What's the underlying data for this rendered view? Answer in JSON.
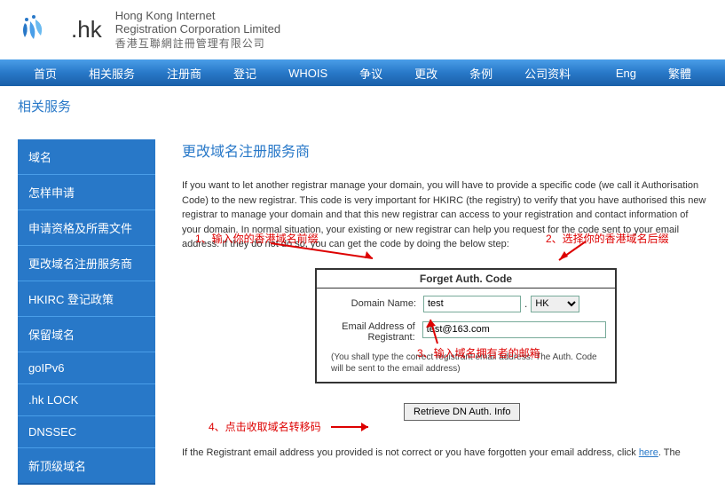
{
  "header": {
    "logo_text": ".hk",
    "org_en": "Hong Kong Internet\nRegistration Corporation Limited",
    "org_cn": "香港互聯網註冊管理有限公司"
  },
  "topnav": {
    "items": [
      "首页",
      "相关服务",
      "注册商",
      "登记",
      "WHOIS",
      "争议",
      "更改",
      "条例",
      "公司资料"
    ],
    "lang": [
      "Eng",
      "繁體"
    ]
  },
  "section_title": "相关服务",
  "sidebar": {
    "items": [
      "域名",
      "怎样申请",
      "申请资格及所需文件",
      "更改域名注册服务商",
      "HKIRC 登记政策",
      "保留域名",
      "goIPv6",
      ".hk LOCK",
      "DNSSEC",
      "新顶级域名"
    ]
  },
  "main": {
    "title": "更改域名注册服务商",
    "intro": "If you want to let another registrar manage your domain, you will have to provide a specific code (we call it Authorisation Code) to the new registrar. This code is very important for HKIRC (the registry) to verify that you have authorised this new registrar to manage your domain and that this new registrar can access to your registration and contact information of your domain. In normal situation, your existing or new registrar can help you request for the code sent to your email address. If they do not do so, you can get the code by doing the below step:",
    "form": {
      "box_title": "Forget Auth. Code",
      "domain_label": "Domain Name:",
      "domain_value": "test",
      "suffix_value": "HK",
      "email_label": "Email Address of Registrant:",
      "email_value": "test@163.com",
      "note": "(You shall type the correct registrant email address. The Auth. Code will be sent to the email address)"
    },
    "retrieve_btn": "Retrieve DN Auth. Info",
    "bottom": "If the Registrant email address you provided is not correct or you have forgotten your email address, click ",
    "bottom_link": "here",
    "bottom_tail": ". The"
  },
  "annotations": {
    "a1": "1、输入你的香港域名前缀",
    "a2": "2、选择你的香港域名后缀",
    "a3": "3、输入域名拥有者的邮箱",
    "a4": "4、点击收取域名转移码"
  }
}
